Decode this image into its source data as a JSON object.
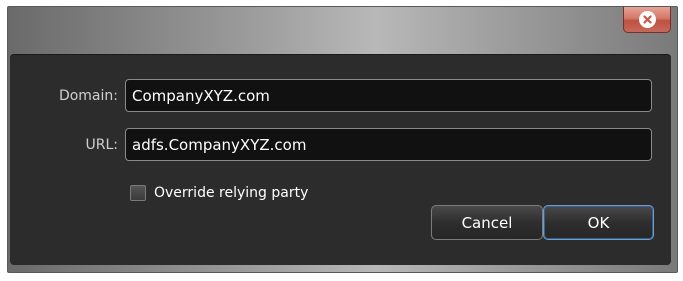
{
  "window": {
    "close_icon": "close-icon",
    "close_color": "#c9584a"
  },
  "form": {
    "domain_label": "Domain:",
    "domain_value": "CompanyXYZ.com",
    "url_label": "URL:",
    "url_value": "adfs.CompanyXYZ.com",
    "override_label": "Override relying party",
    "override_checked": false
  },
  "buttons": {
    "cancel_label": "Cancel",
    "ok_label": "OK"
  }
}
